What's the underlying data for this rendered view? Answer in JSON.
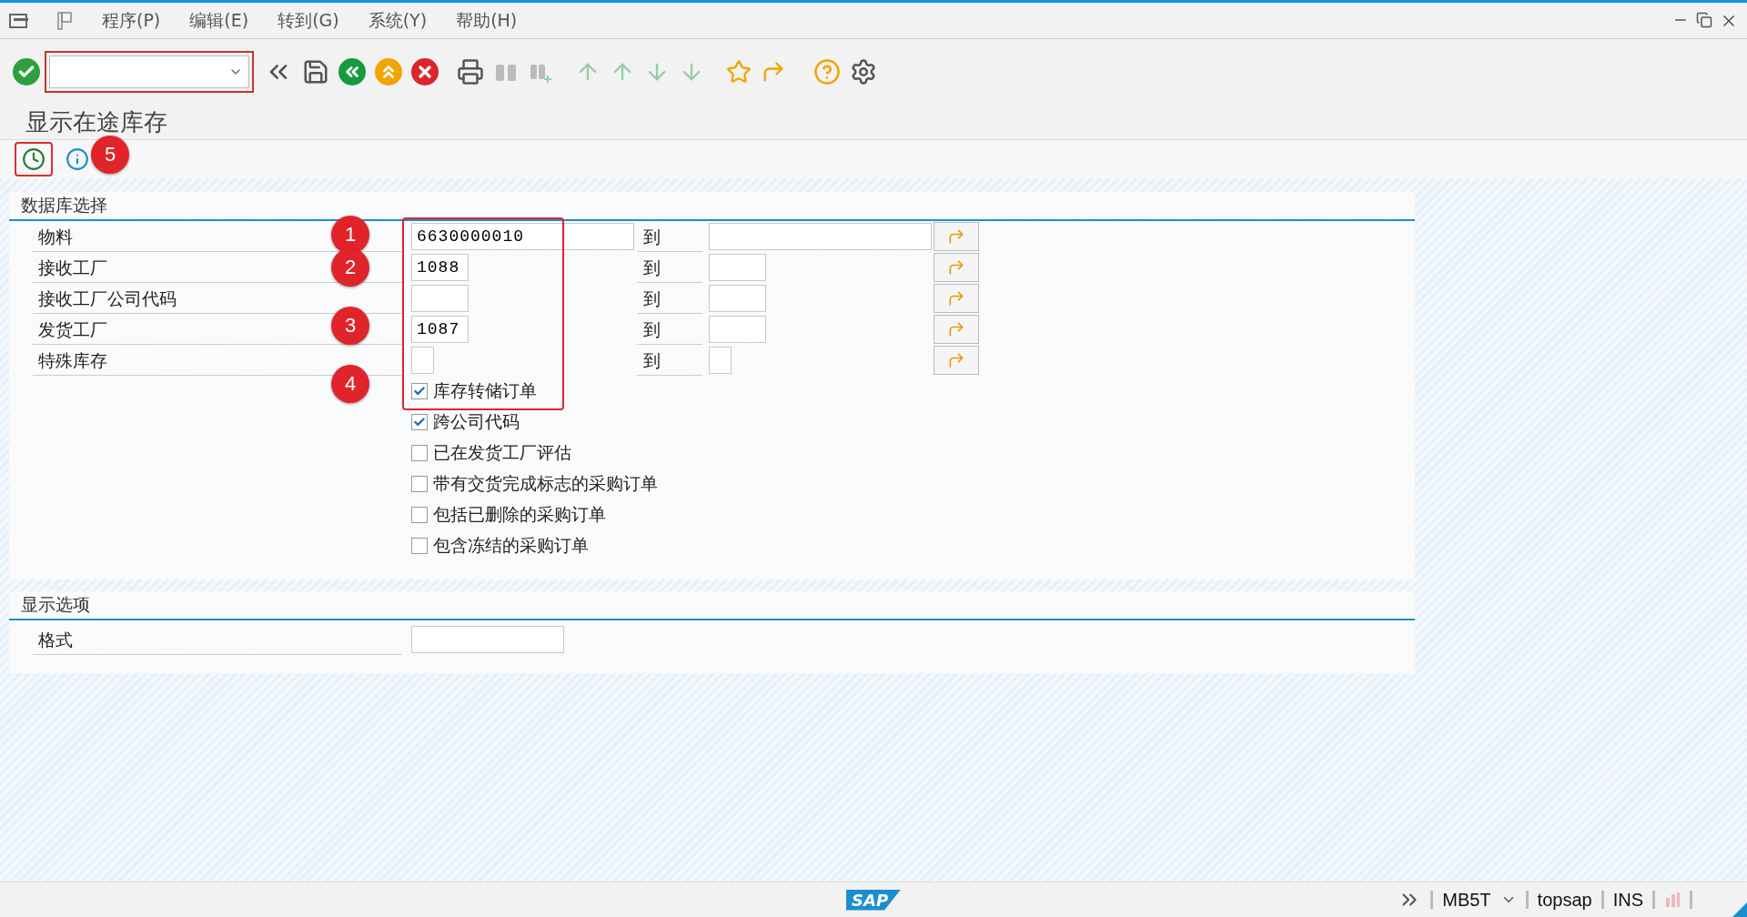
{
  "menu_bar": {
    "items": [
      {
        "label": "程序(P)"
      },
      {
        "label": "编辑(E)"
      },
      {
        "label": "转到(G)"
      },
      {
        "label": "系统(Y)"
      },
      {
        "label": "帮助(H)"
      }
    ]
  },
  "title": "显示在途库存",
  "selection_group": {
    "title": "数据库选择",
    "rows": [
      {
        "label": "物料",
        "from": "6630000010",
        "to_label": "到",
        "kind": "long"
      },
      {
        "label": "接收工厂",
        "from": "1088",
        "to_label": "到",
        "kind": "short"
      },
      {
        "label": "接收工厂公司代码",
        "to_label": "到",
        "kind": "short"
      },
      {
        "label": "发货工厂",
        "from": "1087",
        "to_label": "到",
        "kind": "short"
      },
      {
        "label": "特殊库存",
        "to_label": "到",
        "kind": "tiny"
      }
    ],
    "checkboxes": [
      {
        "label": "库存转储订单",
        "checked": true
      },
      {
        "label": "跨公司代码",
        "checked": true
      },
      {
        "label": "已在发货工厂评估",
        "checked": false
      },
      {
        "label": "带有交货完成标志的采购订单",
        "checked": false
      },
      {
        "label": "包括已删除的采购订单",
        "checked": false
      },
      {
        "label": "包含冻结的采购订单",
        "checked": false
      }
    ]
  },
  "display_group": {
    "title": "显示选项",
    "rows": [
      {
        "label": "格式"
      }
    ]
  },
  "annotations": [
    "1",
    "2",
    "3",
    "4",
    "5"
  ],
  "status_bar": {
    "logo": "SAP",
    "transaction": "MB5T",
    "user": "topsap",
    "mode": "INS"
  }
}
